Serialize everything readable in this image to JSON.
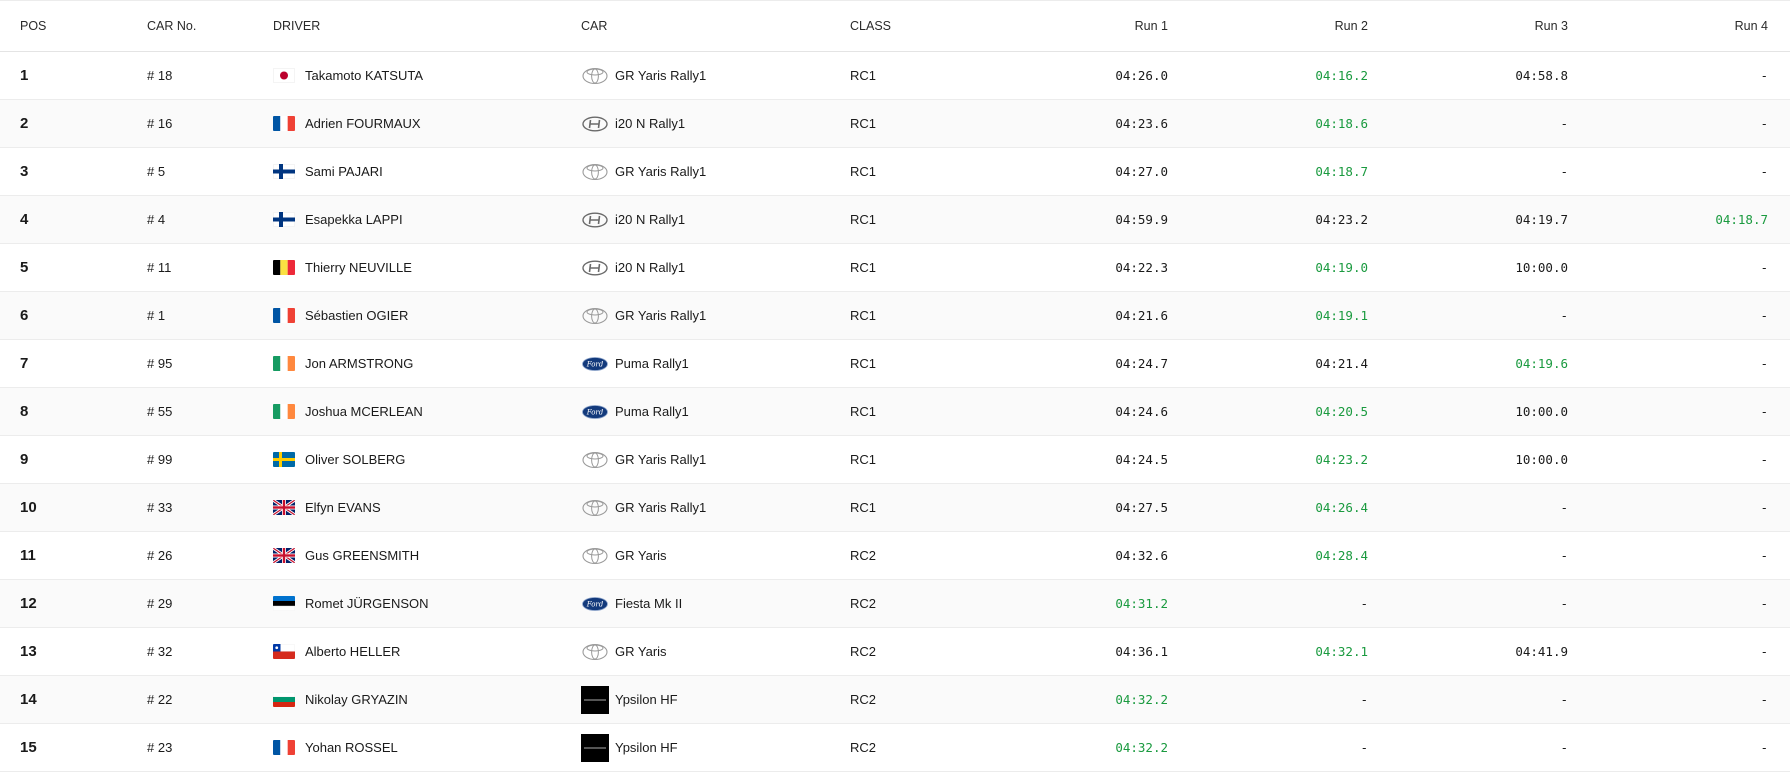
{
  "headers": {
    "pos": "POS",
    "car_no": "CAR No.",
    "driver": "DRIVER",
    "car": "CAR",
    "class": "CLASS",
    "run1": "Run 1",
    "run2": "Run 2",
    "run3": "Run 3",
    "run4": "Run 4"
  },
  "colors": {
    "best": "#1a9a3f",
    "text": "#1a1a1a",
    "row_alt": "#fafafa",
    "border": "#ececec"
  },
  "rows": [
    {
      "pos": "1",
      "car_no": "# 18",
      "flag": "jp",
      "driver": "Takamoto KATSUTA",
      "logo": "toyota-logo",
      "car": "GR Yaris Rally1",
      "class": "RC1",
      "runs": [
        "04:26.0",
        "04:16.2",
        "04:58.8",
        "-"
      ],
      "best": 1
    },
    {
      "pos": "2",
      "car_no": "# 16",
      "flag": "fr",
      "driver": "Adrien FOURMAUX",
      "logo": "hyundai-logo",
      "car": "i20 N Rally1",
      "class": "RC1",
      "runs": [
        "04:23.6",
        "04:18.6",
        "-",
        "-"
      ],
      "best": 1
    },
    {
      "pos": "3",
      "car_no": "# 5",
      "flag": "fi",
      "driver": "Sami PAJARI",
      "logo": "toyota-logo",
      "car": "GR Yaris Rally1",
      "class": "RC1",
      "runs": [
        "04:27.0",
        "04:18.7",
        "-",
        "-"
      ],
      "best": 1
    },
    {
      "pos": "4",
      "car_no": "# 4",
      "flag": "fi",
      "driver": "Esapekka LAPPI",
      "logo": "hyundai-logo",
      "car": "i20 N Rally1",
      "class": "RC1",
      "runs": [
        "04:59.9",
        "04:23.2",
        "04:19.7",
        "04:18.7"
      ],
      "best": 3
    },
    {
      "pos": "5",
      "car_no": "# 11",
      "flag": "be",
      "driver": "Thierry NEUVILLE",
      "logo": "hyundai-logo",
      "car": "i20 N Rally1",
      "class": "RC1",
      "runs": [
        "04:22.3",
        "04:19.0",
        "10:00.0",
        "-"
      ],
      "best": 1
    },
    {
      "pos": "6",
      "car_no": "# 1",
      "flag": "fr",
      "driver": "Sébastien OGIER",
      "logo": "toyota-logo",
      "car": "GR Yaris Rally1",
      "class": "RC1",
      "runs": [
        "04:21.6",
        "04:19.1",
        "-",
        "-"
      ],
      "best": 1
    },
    {
      "pos": "7",
      "car_no": "# 95",
      "flag": "ie",
      "driver": "Jon ARMSTRONG",
      "logo": "ford-logo",
      "car": "Puma Rally1",
      "class": "RC1",
      "runs": [
        "04:24.7",
        "04:21.4",
        "04:19.6",
        "-"
      ],
      "best": 2
    },
    {
      "pos": "8",
      "car_no": "# 55",
      "flag": "ie",
      "driver": "Joshua MCERLEAN",
      "logo": "ford-logo",
      "car": "Puma Rally1",
      "class": "RC1",
      "runs": [
        "04:24.6",
        "04:20.5",
        "10:00.0",
        "-"
      ],
      "best": 1
    },
    {
      "pos": "9",
      "car_no": "# 99",
      "flag": "se",
      "driver": "Oliver SOLBERG",
      "logo": "toyota-logo",
      "car": "GR Yaris Rally1",
      "class": "RC1",
      "runs": [
        "04:24.5",
        "04:23.2",
        "10:00.0",
        "-"
      ],
      "best": 1
    },
    {
      "pos": "10",
      "car_no": "# 33",
      "flag": "gb",
      "driver": "Elfyn EVANS",
      "logo": "toyota-logo",
      "car": "GR Yaris Rally1",
      "class": "RC1",
      "runs": [
        "04:27.5",
        "04:26.4",
        "-",
        "-"
      ],
      "best": 1
    },
    {
      "pos": "11",
      "car_no": "# 26",
      "flag": "gb",
      "driver": "Gus GREENSMITH",
      "logo": "toyota-logo",
      "car": "GR Yaris",
      "class": "RC2",
      "runs": [
        "04:32.6",
        "04:28.4",
        "-",
        "-"
      ],
      "best": 1
    },
    {
      "pos": "12",
      "car_no": "# 29",
      "flag": "ee",
      "driver": "Romet JÜRGENSON",
      "logo": "ford-logo",
      "car": "Fiesta Mk II",
      "class": "RC2",
      "runs": [
        "04:31.2",
        "-",
        "-",
        "-"
      ],
      "best": 0
    },
    {
      "pos": "13",
      "car_no": "# 32",
      "flag": "cl",
      "driver": "Alberto HELLER",
      "logo": "toyota-logo",
      "car": "GR Yaris",
      "class": "RC2",
      "runs": [
        "04:36.1",
        "04:32.1",
        "04:41.9",
        "-"
      ],
      "best": 1
    },
    {
      "pos": "14",
      "car_no": "# 22",
      "flag": "bg",
      "driver": "Nikolay GRYAZIN",
      "logo": "lancia-logo",
      "car": "Ypsilon HF",
      "class": "RC2",
      "runs": [
        "04:32.2",
        "-",
        "-",
        "-"
      ],
      "best": 0
    },
    {
      "pos": "15",
      "car_no": "# 23",
      "flag": "fr",
      "driver": "Yohan ROSSEL",
      "logo": "lancia-logo",
      "car": "Ypsilon HF",
      "class": "RC2",
      "runs": [
        "04:32.2",
        "-",
        "-",
        "-"
      ],
      "best": 0
    }
  ]
}
